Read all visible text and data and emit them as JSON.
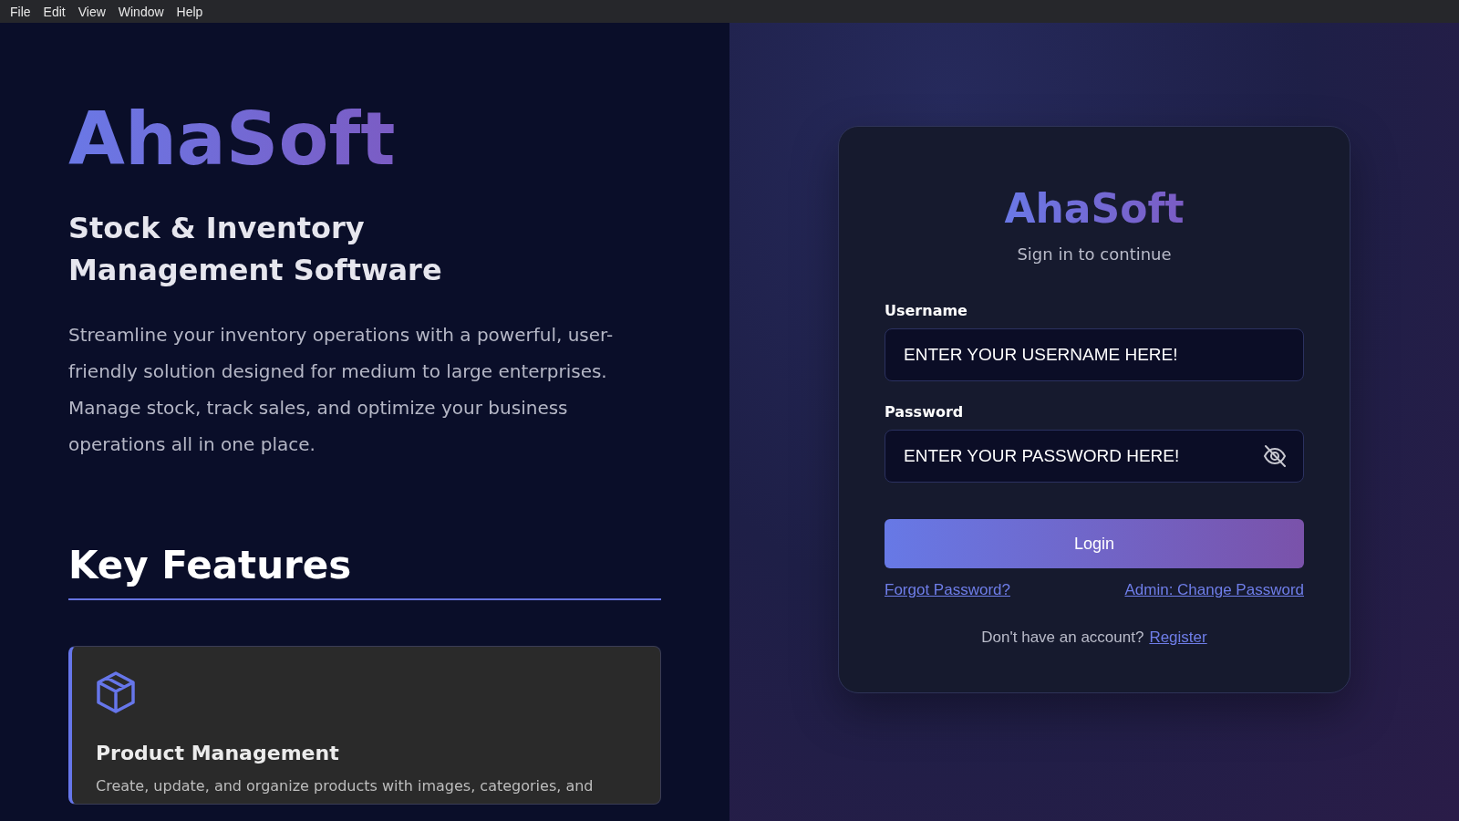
{
  "menu_bar": {
    "items": [
      "File",
      "Edit",
      "View",
      "Window",
      "Help"
    ]
  },
  "intro": {
    "brand": "AhaSoft",
    "subtitle": "Stock & Inventory Management Software",
    "description": "Streamline your inventory operations with a powerful, user-friendly solution designed for medium to large enterprises. Manage stock, track sales, and optimize your business operations all in one place."
  },
  "features": {
    "heading": "Key Features",
    "items": [
      {
        "title": "Product Management",
        "description": "Create, update, and organize products with images, categories, and"
      }
    ]
  },
  "login": {
    "brand": "AhaSoft",
    "subtitle": "Sign in to continue",
    "fields": [
      {
        "label": "Username",
        "placeholder": "ENTER YOUR USERNAME HERE!",
        "kind": "text"
      },
      {
        "label": "Password",
        "placeholder": "ENTER YOUR PASSWORD HERE!",
        "kind": "password"
      }
    ],
    "button": "Login",
    "links": [
      "Forgot Password?",
      "Admin: Change Password"
    ],
    "register_prompt": "Don't have an account?",
    "register_link": "Register"
  }
}
